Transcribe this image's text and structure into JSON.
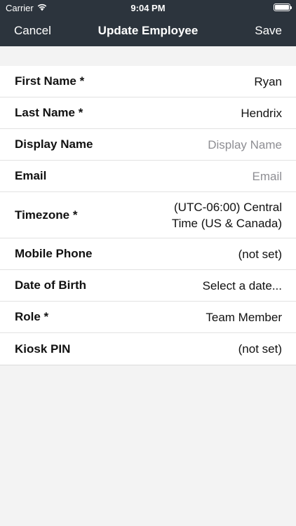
{
  "status_bar": {
    "carrier": "Carrier",
    "time": "9:04 PM",
    "wifi_icon": "wifi-icon",
    "battery_icon": "battery-icon"
  },
  "navbar": {
    "cancel_label": "Cancel",
    "title": "Update Employee",
    "save_label": "Save",
    "background_color": "#2c343d"
  },
  "fields": [
    {
      "label": "First Name *",
      "value": "Ryan"
    },
    {
      "label": "Last Name *",
      "value": "Hendrix"
    },
    {
      "label": "Display Name",
      "placeholder": "Display Name"
    },
    {
      "label": "Email",
      "placeholder": "Email"
    },
    {
      "label": "Timezone *",
      "value": "(UTC-06:00) Central Time (US & Canada)"
    },
    {
      "label": "Mobile Phone",
      "value": "(not set)"
    },
    {
      "label": "Date of Birth",
      "value": "Select a date..."
    },
    {
      "label": "Role *",
      "value": "Team Member"
    },
    {
      "label": "Kiosk PIN",
      "value": "(not set)"
    }
  ]
}
